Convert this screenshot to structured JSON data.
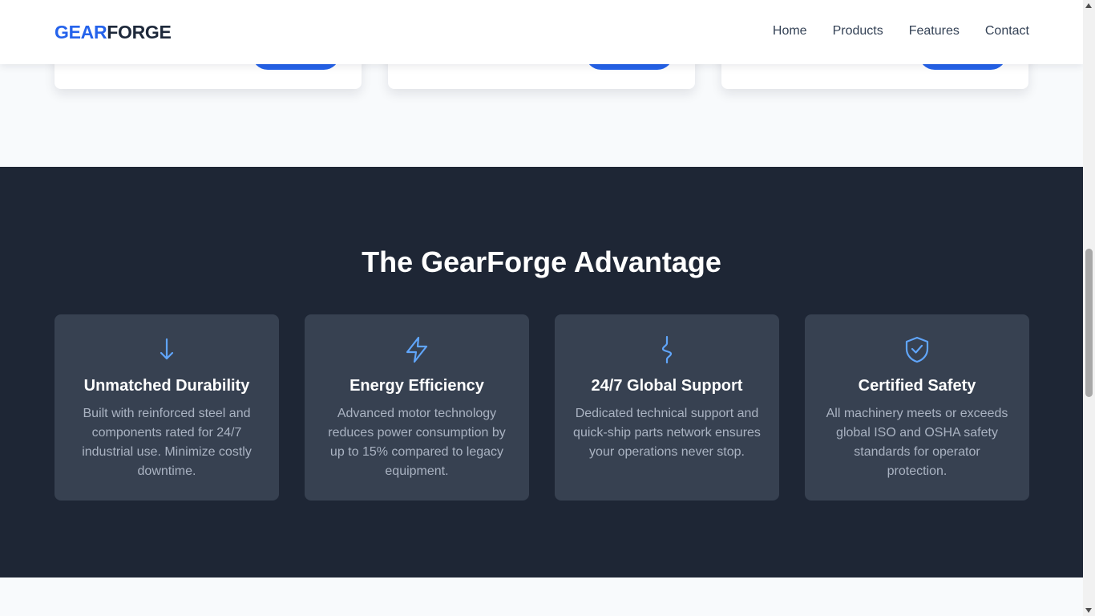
{
  "header": {
    "logo_part1": "GEAR",
    "logo_part2": "FORGE",
    "nav": [
      "Home",
      "Products",
      "Features",
      "Contact"
    ]
  },
  "features": {
    "title": "The GearForge Advantage",
    "items": [
      {
        "icon": "arrow-down-icon",
        "title": "Unmatched Durability",
        "text": "Built with reinforced steel and components rated for 24/7 industrial use. Minimize costly downtime."
      },
      {
        "icon": "lightning-icon",
        "title": "Energy Efficiency",
        "text": "Advanced motor technology reduces power consumption by up to 15% compared to legacy equipment."
      },
      {
        "icon": "support-icon",
        "title": "24/7 Global Support",
        "text": "Dedicated technical support and quick-ship parts network ensures your operations never stop."
      },
      {
        "icon": "shield-check-icon",
        "title": "Certified Safety",
        "text": "All machinery meets or exceeds global ISO and OSHA safety standards for operator protection."
      }
    ]
  },
  "colors": {
    "accent": "#2563eb",
    "dark_section": "#1e2635",
    "card": "#374151",
    "icon": "#60a5fa"
  }
}
